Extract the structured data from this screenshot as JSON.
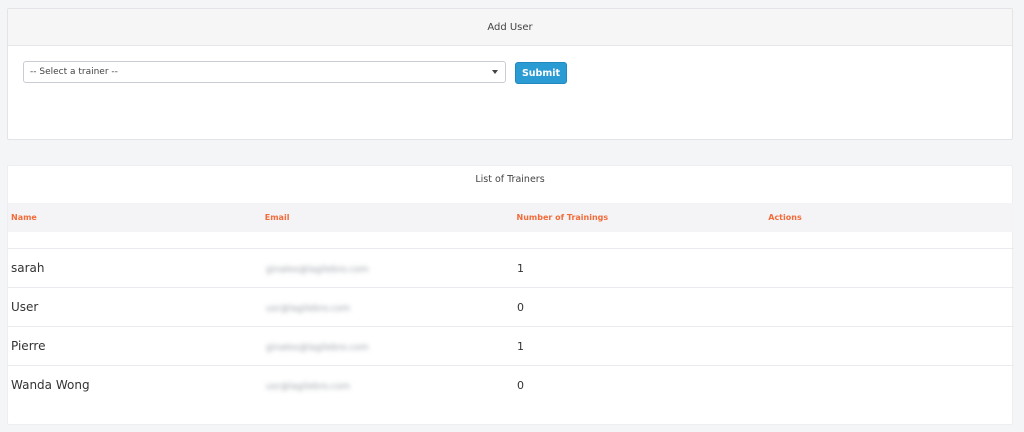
{
  "add_user": {
    "title": "Add User",
    "trainer_select": {
      "selected": "-- Select a trainer --"
    },
    "submit_label": "Submit"
  },
  "trainers": {
    "title": "List of Trainers",
    "columns": [
      "Name",
      "Email",
      "Number of Trainings",
      "Actions"
    ],
    "rows": [
      {
        "name": "sarah",
        "email": "ginalex@lagilebro.com",
        "trainings": "1"
      },
      {
        "name": "User",
        "email": "usr@lagilebro.com",
        "trainings": "0"
      },
      {
        "name": "Pierre",
        "email": "ginalex@lagilebro.com",
        "trainings": "1"
      },
      {
        "name": "Wanda Wong",
        "email": "usr@lagilebro.com",
        "trainings": "0"
      }
    ]
  }
}
